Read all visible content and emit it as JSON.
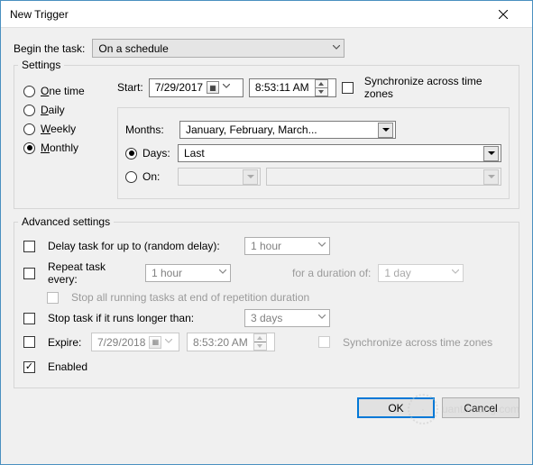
{
  "window": {
    "title": "New Trigger"
  },
  "begin": {
    "label": "Begin the task:",
    "value": "On a schedule"
  },
  "settings": {
    "legend": "Settings",
    "freq": {
      "one_time": "One time",
      "daily": "Daily",
      "weekly": "Weekly",
      "monthly": "Monthly",
      "selected": "monthly"
    },
    "start_label": "Start:",
    "start_date": "7/29/2017",
    "start_time": "8:53:11 AM",
    "sync_label": "Synchronize across time zones",
    "months_label": "Months:",
    "months_value": "January, February, March...",
    "days_label": "Days:",
    "days_value": "Last",
    "on_label": "On:"
  },
  "adv": {
    "legend": "Advanced settings",
    "delay_label": "Delay task for up to (random delay):",
    "delay_value": "1 hour",
    "repeat_label": "Repeat task every:",
    "repeat_value": "1 hour",
    "duration_label": "for a duration of:",
    "duration_value": "1 day",
    "stop_rep_label": "Stop all running tasks at end of repetition duration",
    "stop_long_label": "Stop task if it runs longer than:",
    "stop_long_value": "3 days",
    "expire_label": "Expire:",
    "expire_date": "7/29/2018",
    "expire_time": "8:53:20 AM",
    "sync_label": "Synchronize across time zones",
    "enabled_label": "Enabled"
  },
  "buttons": {
    "ok": "OK",
    "cancel": "Cancel"
  },
  "watermark": "uantrimang.com"
}
